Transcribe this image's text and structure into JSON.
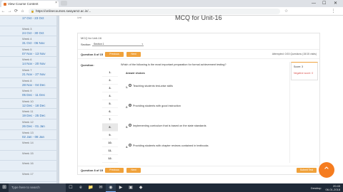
{
  "browser": {
    "tab_title": "View Course Content",
    "tab_close": "×",
    "url": "https://onlinecourses.swayam2.ac.in/...",
    "lock": "🔒",
    "nav_back": "←",
    "nav_forward": "→",
    "nav_reload": "⟳",
    "nav_home": "⌂",
    "win_min": "—",
    "win_max": "☐",
    "win_close": "✕",
    "menu_icon": "⋮",
    "star_icon": "☆"
  },
  "sidebar": {
    "weeks": [
      {
        "name": "",
        "dates": "17 Oct - 23 Oct"
      },
      {
        "name": "Week 3",
        "dates": "24 Oct - 30 Oct"
      },
      {
        "name": "Week 4",
        "dates": "31 Oct - 06 Nov"
      },
      {
        "name": "Week 5",
        "dates": "07 Nov - 13 Nov"
      },
      {
        "name": "Week 6",
        "dates": "14 Nov - 20 Nov"
      },
      {
        "name": "Week 7",
        "dates": "21 Nov - 27 Nov"
      },
      {
        "name": "Week 8",
        "dates": "28 Nov - 04 Dec"
      },
      {
        "name": "Week 9",
        "dates": "05 Dec - 11 Dec"
      },
      {
        "name": "Week 10",
        "dates": "12 Dec - 18 Dec"
      },
      {
        "name": "Week 11",
        "dates": "19 Dec - 25 Dec"
      },
      {
        "name": "Week 12",
        "dates": "26 Dec - 01 Jan"
      },
      {
        "name": "Week 13",
        "dates": "02 Jan - 08 Jan"
      },
      {
        "name": "Week 14",
        "dates": ""
      },
      {
        "name": "Week 15",
        "dates": ""
      },
      {
        "name": "Week 16",
        "dates": ""
      },
      {
        "name": "Week 17",
        "dates": ""
      }
    ]
  },
  "main": {
    "page_title": "MCQ for Unit-16",
    "top_small": "Unit",
    "mcq_label": "MCQ for Unit-16",
    "section_label": "Section:",
    "section_value": "Section 1",
    "section_caret": "▾",
    "question_count": "Question 8 of 15",
    "btn_previous": "Previous",
    "btn_next": "Next",
    "attempted": "Attempted: 0/15 Questions (15/15 visits)",
    "question_label": "Question:",
    "question_numbers": [
      "1.",
      "2.",
      "3.",
      "4.",
      "5.",
      "6.",
      "7.",
      "8.",
      "9.",
      "10.",
      "11.",
      "12."
    ],
    "active_question_index": 7,
    "question_text": "Which of the following is the most important preparation for formal achievement testing?",
    "answer_choices_label": "Answer choices",
    "choices": [
      {
        "num": "1.",
        "text": "Teaching students test-wise skills",
        "selected": false
      },
      {
        "num": "2.",
        "text": "Providing students with good instruction",
        "selected": true
      },
      {
        "num": "3.",
        "text": "Implementing curriculum that is based on the state standards",
        "selected": false
      },
      {
        "num": "4.",
        "text": "Providing students with chapter reviews contained in textbooks",
        "selected": false
      }
    ],
    "score_label": "Score: 3",
    "negative_score": "Negative score: 0",
    "bottom_count": "Question 8 of 15",
    "btn_previous_bottom": "Previous",
    "btn_next_bottom": "Next",
    "btn_submit": "Submit Test",
    "accent_color": "#f0a23b"
  },
  "fab": {
    "icon": "⌃"
  },
  "taskbar": {
    "start_icon": "⊞",
    "search_placeholder": "Type here to search",
    "apps": [
      "☐",
      "e",
      "📁",
      "✉",
      "◉",
      "▶",
      "▣",
      "◆"
    ],
    "tray_label": "Desktop",
    "time": "20:45",
    "date": "06-01-2018"
  }
}
